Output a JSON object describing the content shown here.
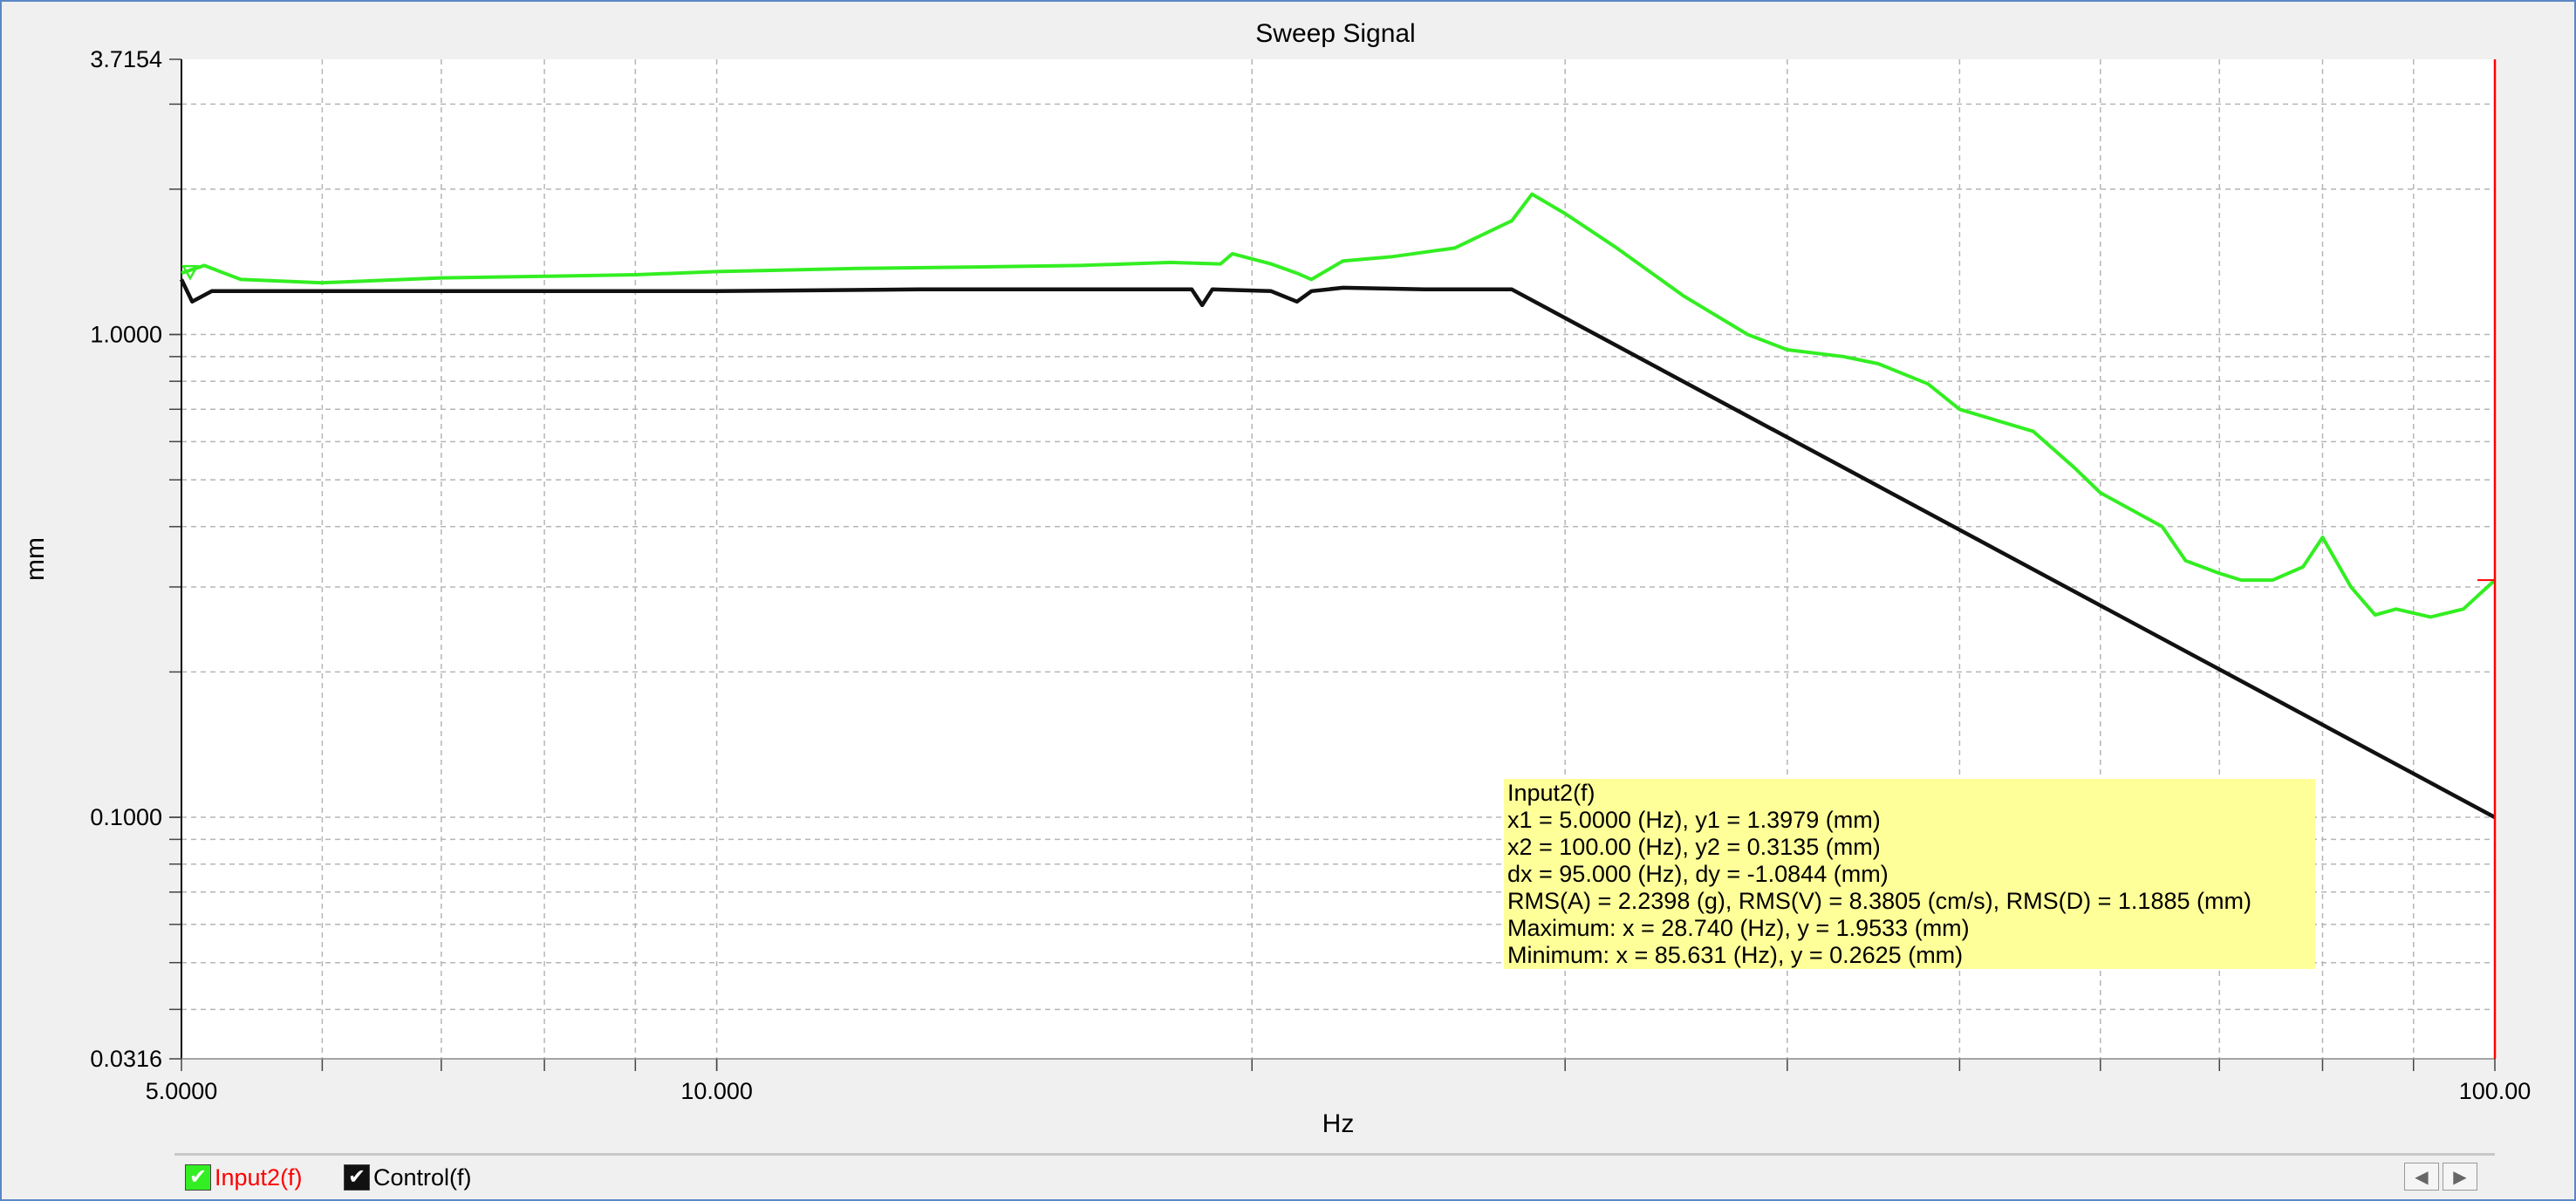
{
  "chart_data": {
    "type": "line",
    "title": "Sweep Signal",
    "xlabel": "Hz",
    "ylabel": "mm",
    "x_scale": "log",
    "y_scale": "log",
    "xlim": [
      5.0,
      100.0
    ],
    "ylim": [
      0.0316,
      3.7154
    ],
    "x_tick_labels": [
      {
        "value": 5.0,
        "label": "5.0000"
      },
      {
        "value": 10.0,
        "label": "10.000"
      },
      {
        "value": 100.0,
        "label": "100.00"
      }
    ],
    "y_tick_labels": [
      {
        "value": 3.7154,
        "label": "3.7154"
      },
      {
        "value": 1.0,
        "label": "1.0000"
      },
      {
        "value": 0.1,
        "label": "0.1000"
      },
      {
        "value": 0.0316,
        "label": "0.0316"
      }
    ],
    "grid": true,
    "cursor_x": 100.0,
    "series": [
      {
        "name": "Input2(f)",
        "color": "#33ee22",
        "x": [
          5.0,
          5.15,
          5.4,
          6.0,
          7.0,
          8.0,
          9.0,
          10.0,
          12.0,
          14.0,
          16.0,
          18.0,
          19.2,
          19.5,
          20.5,
          21.2,
          21.6,
          22.5,
          24.0,
          26.0,
          28.0,
          28.74,
          30.0,
          32.0,
          35.0,
          38.0,
          40.0,
          43.0,
          45.0,
          48.0,
          50.0,
          55.0,
          58.0,
          60.0,
          62.0,
          65.0,
          67.0,
          70.0,
          72.0,
          75.0,
          78.0,
          80.0,
          83.0,
          85.631,
          88.0,
          92.0,
          96.0,
          100.0
        ],
        "y": [
          1.34,
          1.39,
          1.3,
          1.28,
          1.31,
          1.32,
          1.33,
          1.35,
          1.37,
          1.38,
          1.39,
          1.41,
          1.4,
          1.47,
          1.4,
          1.34,
          1.3,
          1.42,
          1.45,
          1.51,
          1.72,
          1.9533,
          1.78,
          1.52,
          1.2,
          1.0,
          0.93,
          0.9,
          0.87,
          0.79,
          0.7,
          0.63,
          0.53,
          0.47,
          0.44,
          0.4,
          0.34,
          0.32,
          0.31,
          0.31,
          0.33,
          0.38,
          0.3,
          0.2625,
          0.27,
          0.26,
          0.27,
          0.31
        ]
      },
      {
        "name": "Control(f)",
        "color": "#111111",
        "x": [
          5.0,
          5.07,
          5.2,
          6.0,
          8.0,
          10.0,
          13.0,
          18.5,
          18.75,
          19.0,
          20.5,
          21.2,
          21.6,
          22.5,
          25.0,
          28.0,
          100.0
        ],
        "y": [
          1.3,
          1.17,
          1.23,
          1.23,
          1.23,
          1.23,
          1.24,
          1.24,
          1.15,
          1.24,
          1.23,
          1.17,
          1.23,
          1.25,
          1.24,
          1.24,
          0.1
        ]
      }
    ]
  },
  "info": {
    "lines": [
      "Input2(f)",
      "x1 = 5.0000 (Hz), y1 = 1.3979 (mm)",
      "x2 = 100.00 (Hz), y2 = 0.3135 (mm)",
      "dx = 95.000 (Hz), dy = -1.0844 (mm)",
      "RMS(A) = 2.2398 (g), RMS(V) = 8.3805 (cm/s), RMS(D) = 1.1885 (mm)",
      "Maximum: x = 28.740 (Hz), y = 1.9533 (mm)",
      "Minimum: x = 85.631 (Hz), y = 0.2625 (mm)"
    ]
  },
  "legend": {
    "items": [
      {
        "label": "Input2(f)",
        "color": "#33ee22",
        "text_color": "#ff0000",
        "checked": true
      },
      {
        "label": "Control(f)",
        "color": "#111111",
        "text_color": "#000000",
        "checked": true
      }
    ],
    "scroll_left_icon": "◀",
    "scroll_right_icon": "▶"
  }
}
